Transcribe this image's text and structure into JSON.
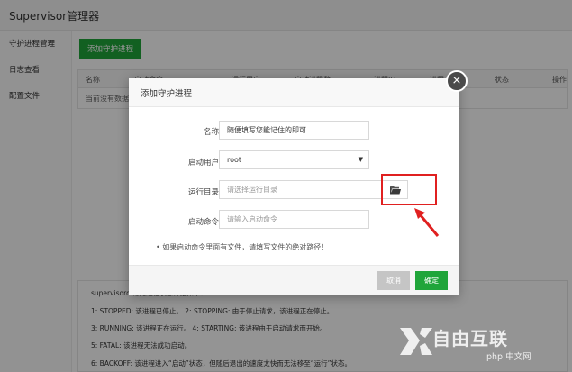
{
  "app": {
    "title": "Supervisor管理器"
  },
  "sidebar": {
    "items": [
      {
        "label": "守护进程管理"
      },
      {
        "label": "日志查看"
      },
      {
        "label": "配置文件"
      }
    ]
  },
  "main": {
    "add_button": "添加守护进程",
    "table": {
      "headers": [
        "名称",
        "启动命令",
        "运行用户",
        "启动进程数",
        "进程ID",
        "进程",
        "状态",
        "操作"
      ],
      "empty": "当前没有数据"
    },
    "info": {
      "lines": [
        "supervisord 常见进程状态详细如下：",
        "1: STOPPED: 该进程已停止。      2: STOPPING: 由于停止请求，该进程正在停止。",
        "3: RUNNING: 该进程正在运行。   4: STARTING: 该进程由于启动请求而开始。",
        "5: FATAL: 该进程无法成功启动。",
        "6: BACKOFF: 该进程进入“启动”状态，但随后退出的速度太快而无法移至“运行”状态。"
      ]
    }
  },
  "modal": {
    "title": "添加守护进程",
    "fields": {
      "name": {
        "label": "名称",
        "value": "随便填写您能记住的即可"
      },
      "user": {
        "label": "启动用户",
        "value": "root"
      },
      "dir": {
        "label": "运行目录",
        "placeholder": "请选择运行目录"
      },
      "command": {
        "label": "启动命令",
        "placeholder": "请输入启动命令"
      }
    },
    "hint": "• 如果启动命令里面有文件，请填写文件的绝对路径！",
    "cancel": "取消",
    "confirm": "确定",
    "close_glyph": "×"
  },
  "watermark": {
    "brand": "自由互联",
    "site": "php 中文网"
  },
  "colors": {
    "primary": "#20a53a",
    "annotation": "#e02020",
    "overlay": "rgba(0,0,0,0.42)"
  }
}
